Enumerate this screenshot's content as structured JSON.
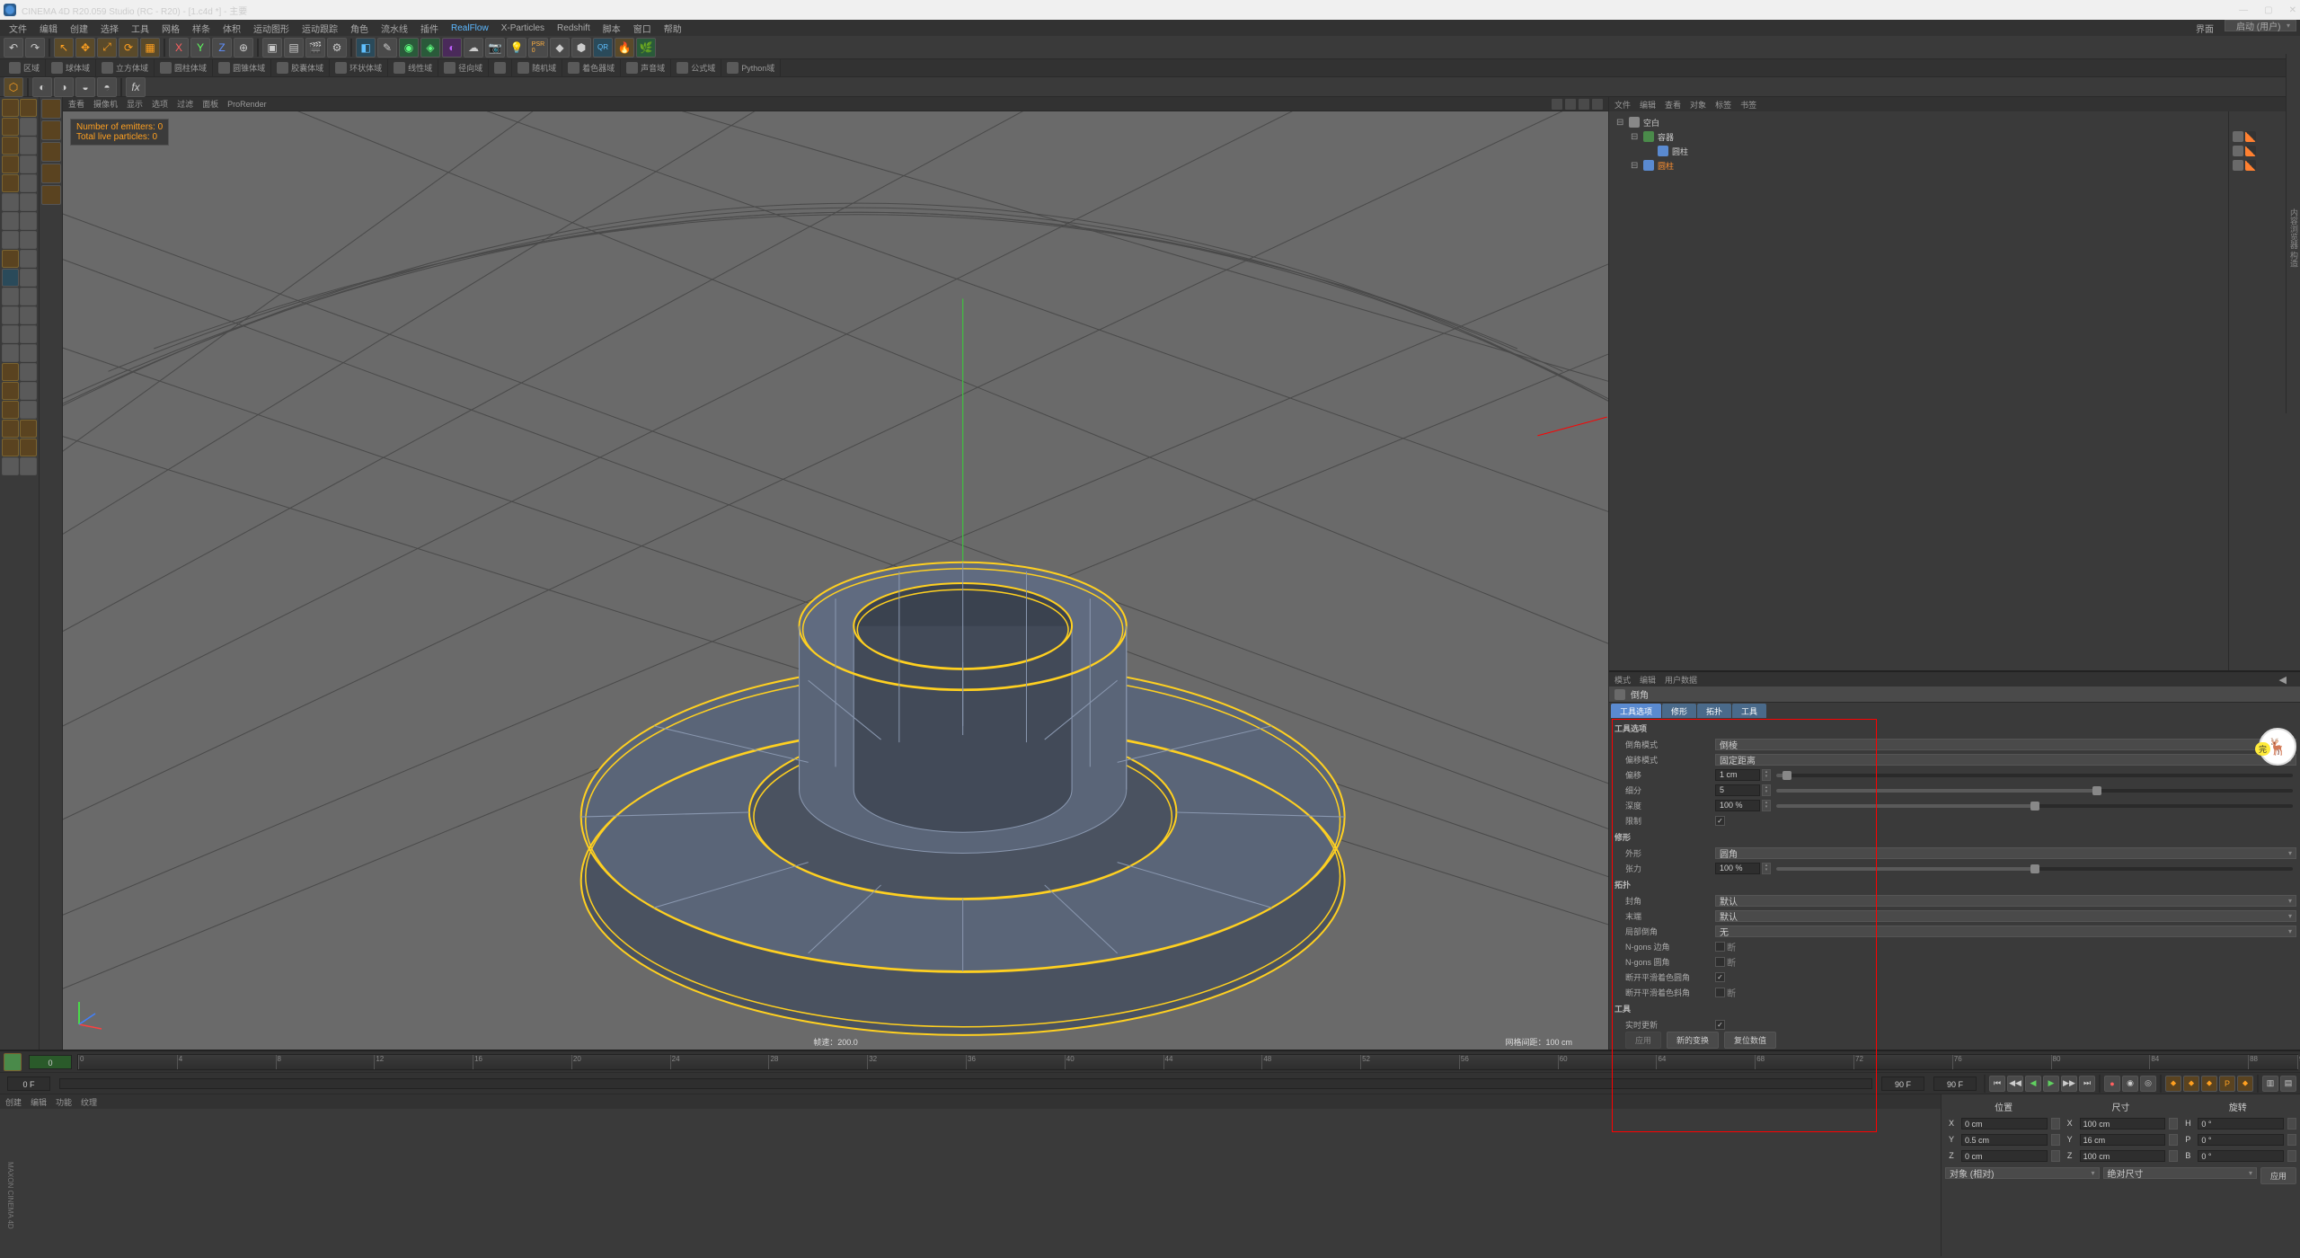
{
  "title": "CINEMA 4D R20.059 Studio (RC - R20) - [1.c4d *] - 主要",
  "menubar": [
    "文件",
    "编辑",
    "创建",
    "选择",
    "工具",
    "网格",
    "样条",
    "体积",
    "运动图形",
    "运动跟踪",
    "角色",
    "流水线",
    "插件",
    "RealFlow",
    "X-Particles",
    "Redshift",
    "脚本",
    "窗口",
    "帮助"
  ],
  "menubar_right": {
    "label": "界面",
    "value": "启动 (用户)"
  },
  "palettes": [
    "区域",
    "球体域",
    "立方体域",
    "圆柱体域",
    "圆锥体域",
    "胶囊体域",
    "环状体域",
    "线性域",
    "径向域",
    "",
    "随机域",
    "着色器域",
    "声音域",
    "公式域",
    "Python域"
  ],
  "vmenu": [
    "查看",
    "摄像机",
    "显示",
    "选项",
    "过滤",
    "面板",
    "ProRender"
  ],
  "overlay": {
    "emit": "Number of emitters: 0",
    "part": "Total live particles: 0"
  },
  "vstatus1": "帧速：200.0",
  "vstatus2": "网格间距：100 cm",
  "objmenu": [
    "文件",
    "编辑",
    "查看",
    "对象",
    "标签",
    "书签"
  ],
  "objects": [
    {
      "name": "空白",
      "indent": 0,
      "ic": "null",
      "sel": false
    },
    {
      "name": "容器",
      "indent": 1,
      "ic": "green",
      "sel": false
    },
    {
      "name": "圆柱",
      "indent": 2,
      "ic": "blue",
      "sel": false
    },
    {
      "name": "圆柱",
      "indent": 1,
      "ic": "blue",
      "sel": true
    }
  ],
  "attrmenu": [
    "模式",
    "编辑",
    "用户数据"
  ],
  "attrtitle": "倒角",
  "tabs": [
    "工具选项",
    "修形",
    "拓扑",
    "工具"
  ],
  "sect1": "工具选项",
  "props1": [
    {
      "label": "倒角模式",
      "type": "select",
      "value": "倒棱"
    },
    {
      "label": "偏移模式",
      "type": "select",
      "value": "固定距离"
    },
    {
      "label": "偏移",
      "type": "numslider",
      "value": "1 cm",
      "pct": 2
    },
    {
      "label": "细分",
      "type": "numslider",
      "value": "5",
      "pct": 62
    },
    {
      "label": "深度",
      "type": "numslider",
      "value": "100 %",
      "pct": 50
    },
    {
      "label": "限制",
      "type": "check",
      "checked": true
    }
  ],
  "sect2": "修形",
  "props2": [
    {
      "label": "外形",
      "type": "select",
      "value": "圆角"
    },
    {
      "label": "张力",
      "type": "numslider",
      "value": "100 %",
      "pct": 50
    }
  ],
  "sect3": "拓扑",
  "props3": [
    {
      "label": "封角",
      "type": "select",
      "value": "默认"
    },
    {
      "label": "末端",
      "type": "select",
      "value": "默认"
    },
    {
      "label": "局部倒角",
      "type": "select",
      "value": "无"
    },
    {
      "label": "N-gons 边角",
      "type": "check",
      "checked": false,
      "text": "断"
    },
    {
      "label": "N-gons 圆角",
      "type": "check",
      "checked": false,
      "text": "断"
    },
    {
      "label": "断开平滑着色圆角",
      "type": "check",
      "checked": true
    },
    {
      "label": "断开平滑着色斜角",
      "type": "check",
      "checked": false,
      "text": "断"
    }
  ],
  "sect4": "工具",
  "props4": [
    {
      "label": "实时更新",
      "type": "check",
      "checked": true
    }
  ],
  "buttons": [
    "应用",
    "新的变换",
    "复位数值"
  ],
  "timeline": {
    "start": "0",
    "end": "90 F",
    "cur": "0 F",
    "marks": [
      0,
      4,
      8,
      12,
      16,
      20,
      24,
      28,
      32,
      36,
      40,
      44,
      48,
      52,
      56,
      60,
      64,
      68,
      72,
      76,
      80,
      84,
      88,
      90
    ]
  },
  "matmenu": [
    "创建",
    "编辑",
    "功能",
    "纹理"
  ],
  "coord": {
    "head": [
      "位置",
      "尺寸",
      "旋转"
    ],
    "rows": [
      {
        "axis": "X",
        "p": "0 cm",
        "s": "100 cm",
        "r": "0 °",
        "h": "H"
      },
      {
        "axis": "Y",
        "p": "0.5 cm",
        "s": "16 cm",
        "r": "0 °",
        "h": "P"
      },
      {
        "axis": "Z",
        "p": "0 cm",
        "s": "100 cm",
        "r": "0 °",
        "h": "B"
      }
    ],
    "mode": "对象 (相对)",
    "size": "绝对尺寸",
    "apply": "应用"
  },
  "watermark": "🦌"
}
